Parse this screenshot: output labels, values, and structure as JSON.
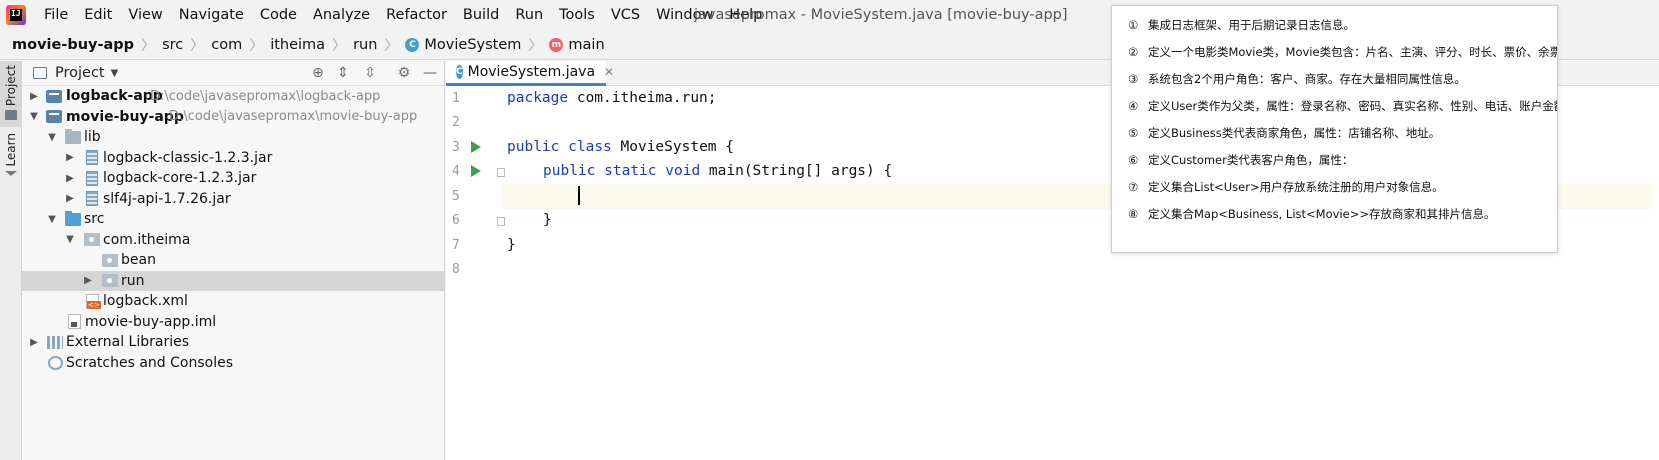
{
  "menubar": {
    "items": [
      "File",
      "Edit",
      "View",
      "Navigate",
      "Code",
      "Analyze",
      "Refactor",
      "Build",
      "Run",
      "Tools",
      "VCS",
      "Window",
      "Help"
    ],
    "window_title": "javasepromax - MovieSystem.java [movie-buy-app]"
  },
  "breadcrumb": {
    "items": [
      "movie-buy-app",
      "src",
      "com",
      "itheima",
      "run",
      "MovieSystem",
      "main"
    ]
  },
  "toolstrip": {
    "project_label": "Project",
    "learn_label": "Learn"
  },
  "project_panel": {
    "title": "Project",
    "tree": [
      {
        "label": "logback-app",
        "path": "D:\\code\\javasepromax\\logback-app"
      },
      {
        "label": "movie-buy-app",
        "path": "D:\\code\\javasepromax\\movie-buy-app"
      },
      {
        "label": "lib"
      },
      {
        "label": "logback-classic-1.2.3.jar"
      },
      {
        "label": "logback-core-1.2.3.jar"
      },
      {
        "label": "slf4j-api-1.7.26.jar"
      },
      {
        "label": "src"
      },
      {
        "label": "com.itheima"
      },
      {
        "label": "bean"
      },
      {
        "label": "run"
      },
      {
        "label": "logback.xml"
      },
      {
        "label": "movie-buy-app.iml"
      },
      {
        "label": "External Libraries"
      },
      {
        "label": "Scratches and Consoles"
      }
    ]
  },
  "editor": {
    "tab_label": "MovieSystem.java",
    "line_numbers": [
      "1",
      "2",
      "3",
      "4",
      "5",
      "6",
      "7",
      "8"
    ],
    "code": {
      "l1_kw": "package",
      "l1_rest": " com.itheima.run;",
      "l3_kw1": "public",
      "l3_kw2": "class",
      "l3_rest": " MovieSystem {",
      "l4_kw1": "public",
      "l4_kw2": "static",
      "l4_kw3": "void",
      "l4_rest": " main(String[] args) {",
      "l6": "}",
      "l7": "}"
    }
  },
  "notes": [
    {
      "num": "①",
      "text": "集成日志框架、用于后期记录日志信息。"
    },
    {
      "num": "②",
      "text": "定义一个电影类Movie类，Movie类包含：片名、主演、评分、时长、票价、余票"
    },
    {
      "num": "③",
      "text": "系统包含2个用户角色：客户、商家。存在大量相同属性信息。"
    },
    {
      "num": "④",
      "text": "定义User类作为父类，属性：登录名称、密码、真实名称、性别、电话、账户金额"
    },
    {
      "num": "⑤",
      "text": "定义Business类代表商家角色，属性：店铺名称、地址。"
    },
    {
      "num": "⑥",
      "text": "定义Customer类代表客户角色，属性："
    },
    {
      "num": "⑦",
      "text": "定义集合List<User>用户存放系统注册的用户对象信息。"
    },
    {
      "num": "⑧",
      "text": "定义集合Map<Business, List<Movie>>存放商家和其排片信息。"
    }
  ],
  "colors": {
    "keyword": "#1d3cb3",
    "run_marker": "#3ca34a",
    "tab_underline": "#4083c9",
    "selection": "#d5d5d5"
  }
}
